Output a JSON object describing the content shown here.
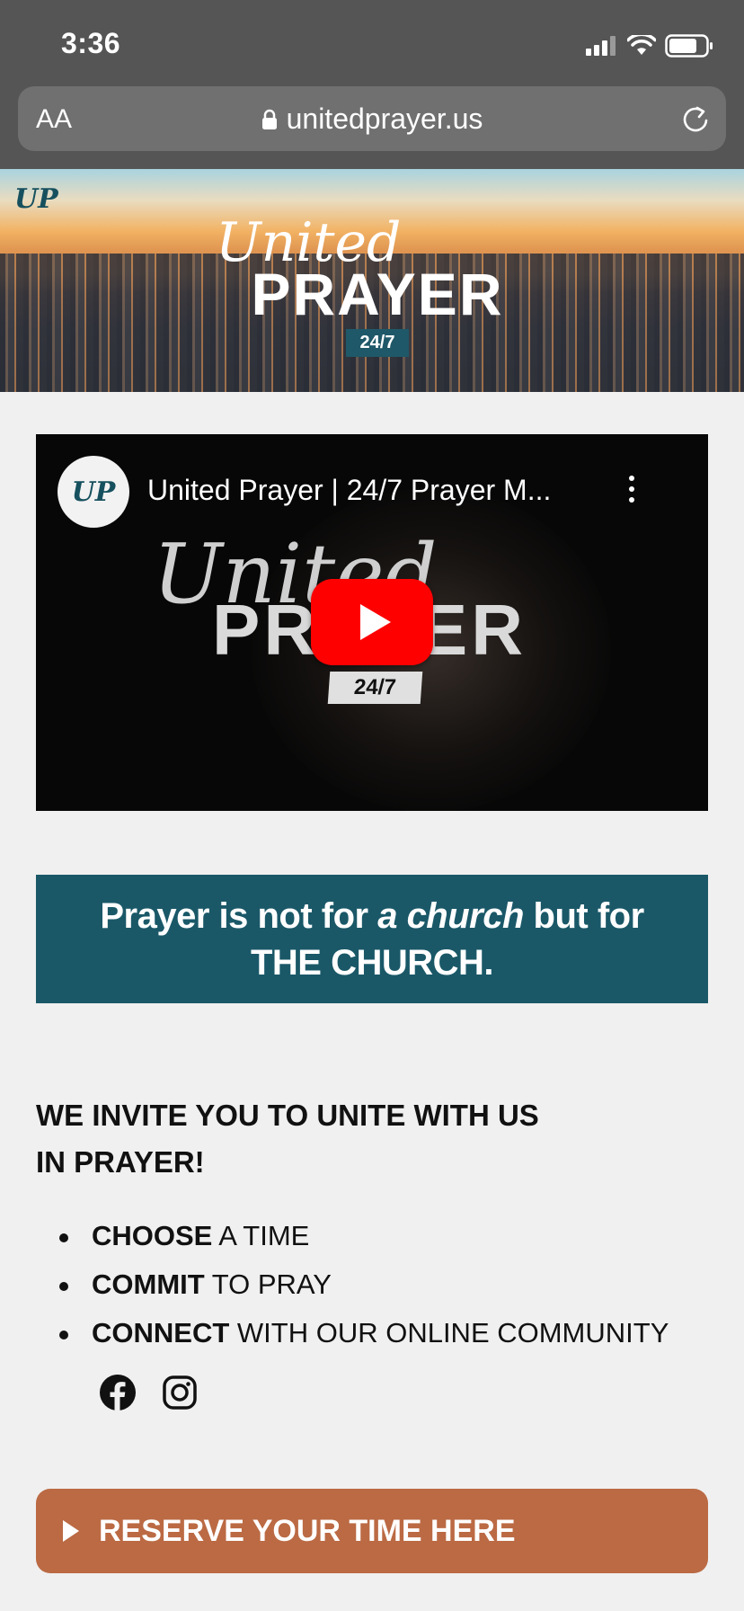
{
  "status_bar": {
    "time": "3:36"
  },
  "browser": {
    "text_size_label": "AA",
    "url": "unitedprayer.us"
  },
  "banner": {
    "logo": "UP",
    "united": "United",
    "prayer": "PRAYER",
    "badge": "24/7"
  },
  "video": {
    "channel_avatar": "UP",
    "title": "United Prayer | 24/7 Prayer M...",
    "overlay_united": "United",
    "overlay_prayer": "PRAYER",
    "overlay_badge": "24/7"
  },
  "quote": {
    "part1": "Prayer is not for ",
    "emph": "a church",
    "part2": " but for",
    "line2": "THE CHURCH."
  },
  "invite": {
    "line1": "WE INVITE YOU TO UNITE WITH US",
    "line2": "IN PRAYER!"
  },
  "steps": [
    {
      "bold": "CHOOSE",
      "rest": " A TIME"
    },
    {
      "bold": "COMMIT",
      "rest": " TO PRAY"
    },
    {
      "bold": "CONNECT",
      "rest": " WITH OUR ONLINE COMMUNITY"
    }
  ],
  "social": {
    "icons": [
      "facebook-icon",
      "instagram-icon"
    ]
  },
  "cta": {
    "label": "RESERVE YOUR TIME HERE"
  },
  "colors": {
    "chrome": "#555555",
    "quote_bg": "#1a5868",
    "cta_bg": "#bb6a44",
    "play": "#ff0000",
    "page_bg": "#f0f0f0"
  }
}
